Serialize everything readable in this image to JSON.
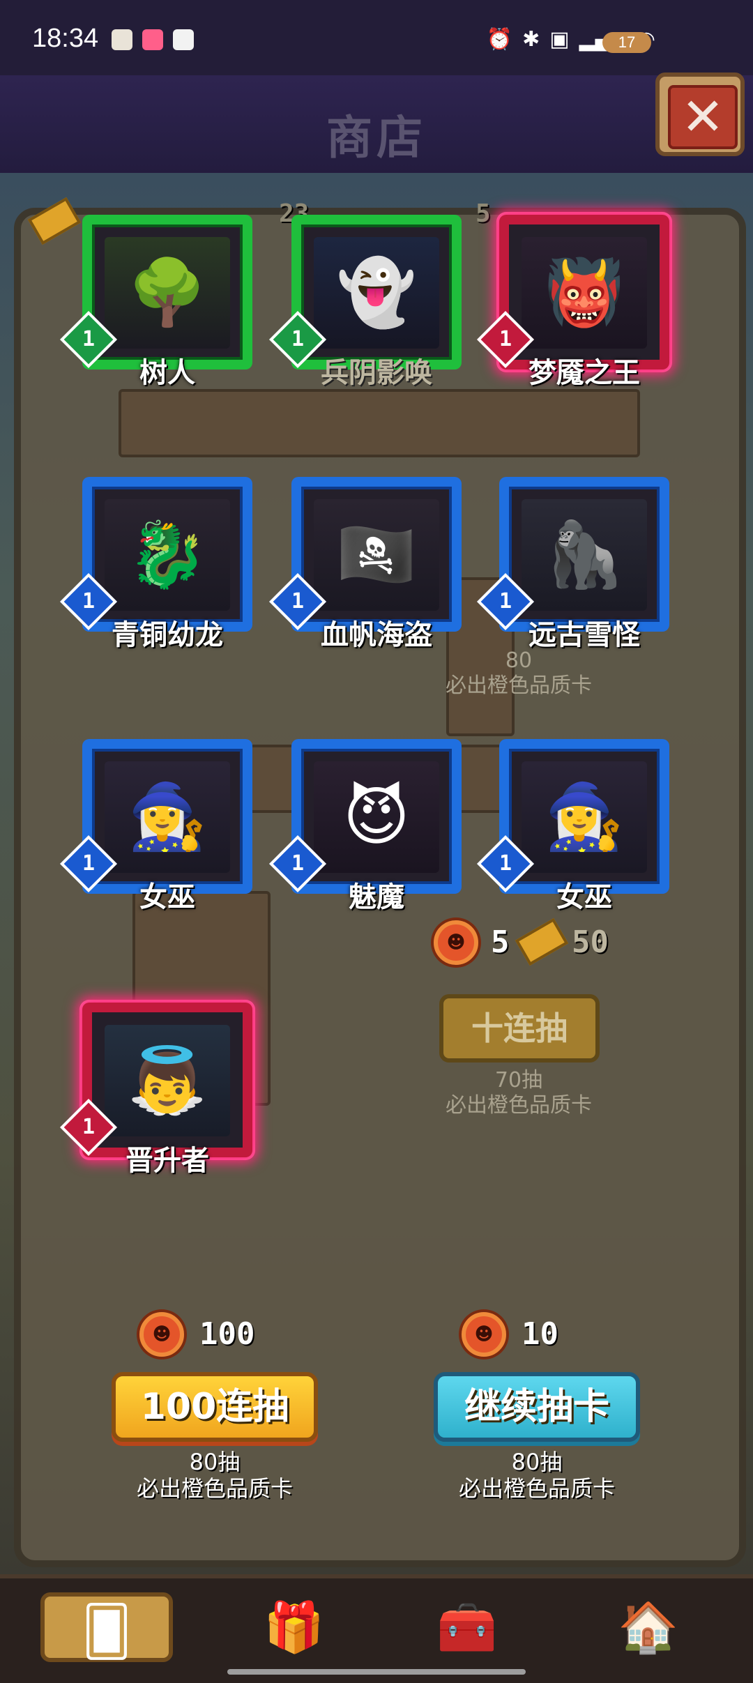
{
  "status_bar": {
    "time": "18:34",
    "battery": "17",
    "icons": [
      "notification-app-icon",
      "notification-app-icon",
      "notification-app-icon",
      "alarm-icon",
      "bluetooth-icon",
      "hd-icon",
      "5g-signal-icon",
      "wifi-icon"
    ]
  },
  "header": {
    "title": "商店",
    "close_label": "✕"
  },
  "cards": [
    {
      "name": "树人",
      "level": "1",
      "rarity": "green"
    },
    {
      "name": "兵阴影唤",
      "level": "1",
      "rarity": "green"
    },
    {
      "name": "梦魇之王",
      "level": "1",
      "rarity": "red"
    },
    {
      "name": "青铜幼龙",
      "level": "1",
      "rarity": "blue"
    },
    {
      "name": "血帆海盗",
      "level": "1",
      "rarity": "blue"
    },
    {
      "name": "远古雪怪",
      "level": "1",
      "rarity": "blue"
    },
    {
      "name": "女巫",
      "level": "1",
      "rarity": "blue"
    },
    {
      "name": "魅魔",
      "level": "1",
      "rarity": "blue"
    },
    {
      "name": "女巫",
      "level": "1",
      "rarity": "blue"
    },
    {
      "name": "晋升者",
      "level": "1",
      "rarity": "red"
    }
  ],
  "background": {
    "cost_top_1": "23",
    "cost_top_2": "5",
    "mid_sub_1": "80",
    "mid_sub_2": "必出橙色品质卡",
    "cost_mid": "5",
    "cost_mid_2": "50",
    "ten_pull_label": "十连抽",
    "ten_sub_1": "70抽",
    "ten_sub_2": "必出橙色品质卡"
  },
  "actions": {
    "pull100": {
      "cost": "100",
      "label": "100连抽",
      "sub1": "80抽",
      "sub2": "必出橙色品质卡"
    },
    "continue": {
      "cost": "10",
      "label": "继续抽卡",
      "sub1": "80抽",
      "sub2": "必出橙色品质卡"
    }
  },
  "nav": {
    "items": [
      "cards-icon",
      "gift-icon",
      "treasure-chest-icon",
      "house-icon"
    ]
  },
  "colors": {
    "green_frame": "#1fbf3c",
    "blue_frame": "#1f6fe0",
    "red_frame": "#c21a3c",
    "gold_button": "#f0a51e",
    "teal_button": "#2fb1cc"
  }
}
